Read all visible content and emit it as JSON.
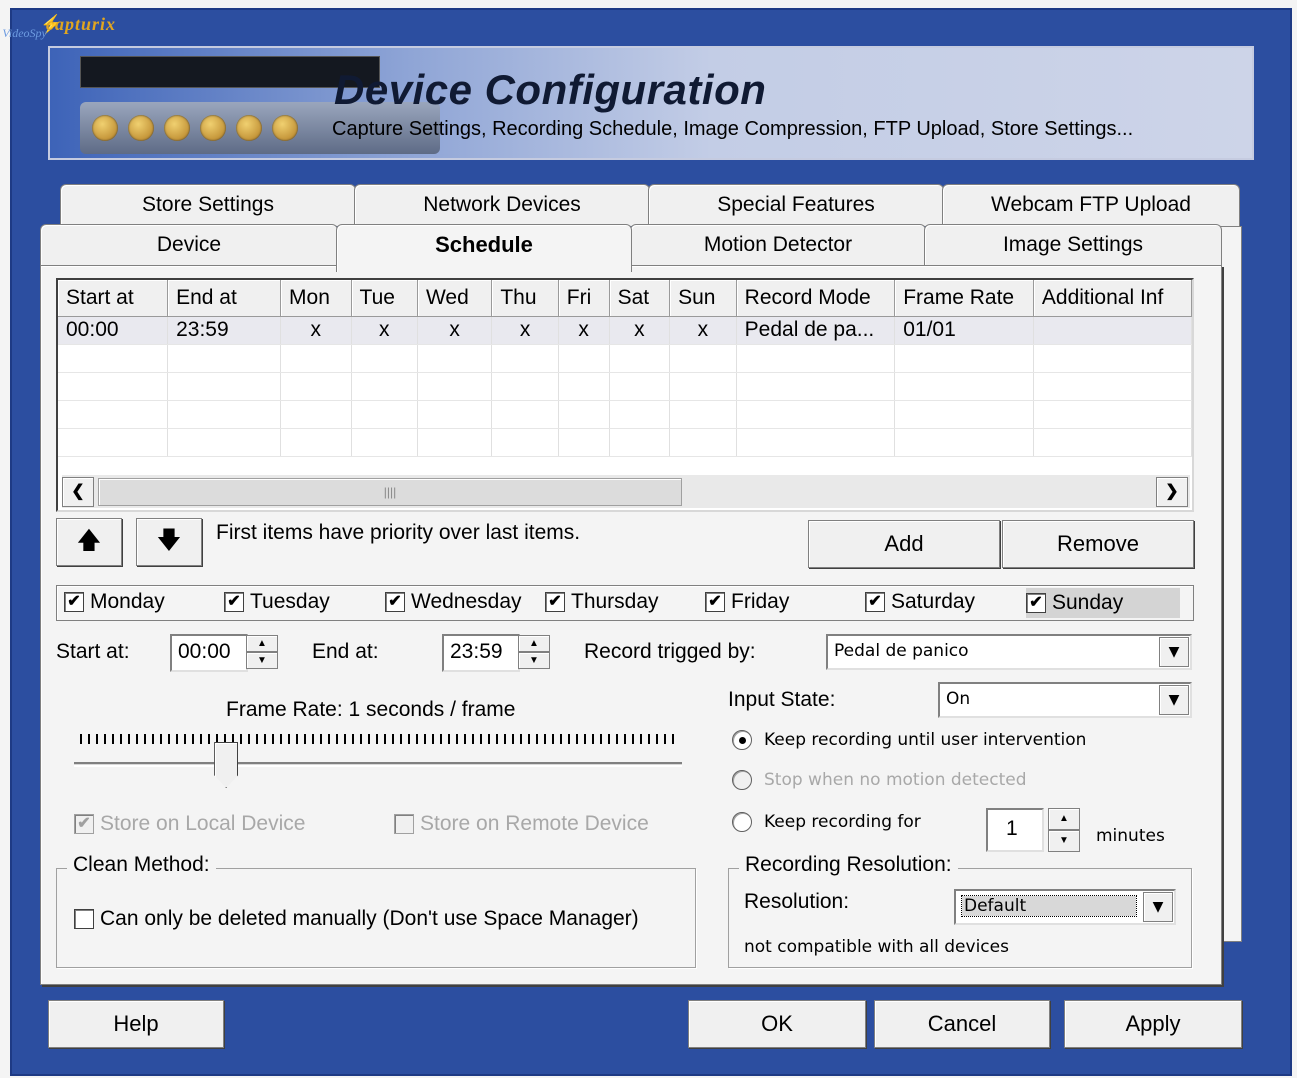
{
  "logo": {
    "brand": "capturix",
    "product": "VideoSpy"
  },
  "header": {
    "title": "Device Configuration",
    "subtitle": "Capture Settings, Recording Schedule,  Image Compression, FTP Upload, Store Settings..."
  },
  "tabs_back": [
    "Store Settings",
    "Network Devices",
    "Special Features",
    "Webcam FTP Upload"
  ],
  "tabs_front": [
    "Device",
    "Schedule",
    "Motion Detector",
    "Image Settings"
  ],
  "active_tab": "Schedule",
  "schedule_table": {
    "columns": [
      "Start at",
      "End at",
      "Mon",
      "Tue",
      "Wed",
      "Thu",
      "Fri",
      "Sat",
      "Sun",
      "Record Mode",
      "Frame Rate",
      "Additional Inf"
    ],
    "rows": [
      [
        "00:00",
        "23:59",
        "x",
        "x",
        "x",
        "x",
        "x",
        "x",
        "x",
        "Pedal de pa...",
        "01/01",
        ""
      ]
    ]
  },
  "scrollbar": {
    "grip": "||||"
  },
  "priority_note": "First items have priority over last items.",
  "buttons": {
    "add": "Add",
    "remove": "Remove",
    "help": "Help",
    "ok": "OK",
    "cancel": "Cancel",
    "apply": "Apply",
    "up": "🡅",
    "down": "🡇"
  },
  "days": [
    {
      "label": "Monday",
      "checked": true
    },
    {
      "label": "Tuesday",
      "checked": true
    },
    {
      "label": "Wednesday",
      "checked": true
    },
    {
      "label": "Thursday",
      "checked": true
    },
    {
      "label": "Friday",
      "checked": true
    },
    {
      "label": "Saturday",
      "checked": true
    },
    {
      "label": "Sunday",
      "checked": true
    }
  ],
  "time": {
    "start_label": "Start at:",
    "start_value": "00:00",
    "end_label": "End at:",
    "end_value": "23:59"
  },
  "record_trigger": {
    "label": "Record trigged by:",
    "value": "Pedal de panico"
  },
  "input_state": {
    "label": "Input State:",
    "value": "On"
  },
  "frame_rate": {
    "label": "Frame Rate: 1 seconds / frame",
    "slider_fraction": 0.24
  },
  "recording_options": {
    "keep_until_intervention": "Keep recording until user intervention",
    "stop_no_motion": "Stop when no motion detected",
    "keep_for": "Keep recording for",
    "keep_for_value": "1",
    "minutes": "minutes",
    "selected": "keep_until_intervention"
  },
  "store": {
    "local": "Store on Local Device",
    "local_checked": true,
    "remote": "Store on Remote Device",
    "remote_checked": false
  },
  "clean_method": {
    "group_label": "Clean Method:",
    "manual_label": "Can only be deleted manually (Don't use Space Manager)",
    "manual_checked": false
  },
  "resolution": {
    "group_label": "Recording Resolution:",
    "label": "Resolution:",
    "value": "Default",
    "note": "not compatible with all devices"
  },
  "glyphs": {
    "check": "✔",
    "dropdown": "▼",
    "left": "❮",
    "right": "❯",
    "spin_up": "▲",
    "spin_down": "▼"
  },
  "colors": {
    "frame_blue": "#2c4ea0",
    "dialog_face": "#f4f4f4"
  }
}
